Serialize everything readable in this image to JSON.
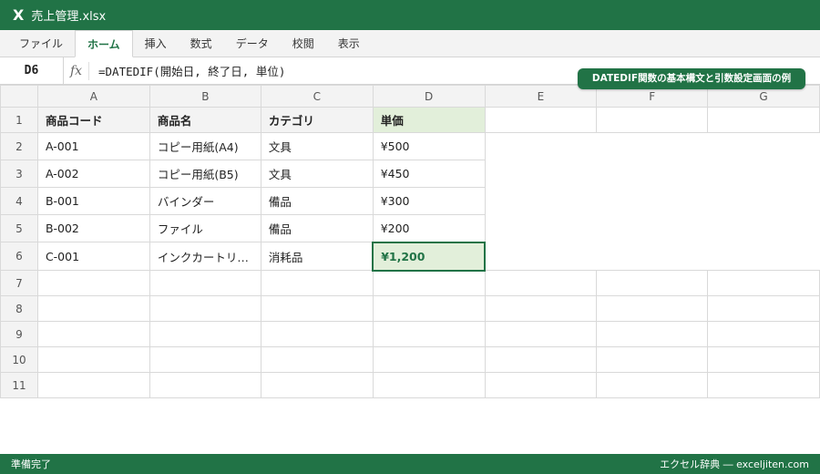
{
  "window": {
    "icon": "excel-x-icon",
    "logo_text": "X",
    "filename": "売上管理.xlsx"
  },
  "ribbon": {
    "tabs": [
      "ファイル",
      "ホーム",
      "挿入",
      "数式",
      "データ",
      "校閲",
      "表示"
    ],
    "active_tab": "ホーム"
  },
  "formula_bar": {
    "cell_ref": "D6",
    "fx_label": "fx",
    "formula": "=DATEDIF(開始日, 終了日, 単位)"
  },
  "callout": "DATEDIF関数の基本構文と引数設定画面の例",
  "sheet": {
    "columns": [
      "A",
      "B",
      "C",
      "D",
      "E",
      "F",
      "G"
    ],
    "row_numbers": [
      "1",
      "2",
      "3",
      "4",
      "5",
      "6",
      "7",
      "8",
      "9",
      "10",
      "11"
    ],
    "headers": [
      "商品コード",
      "商品名",
      "カテゴリ",
      "単価"
    ],
    "rows": [
      [
        "A-001",
        "コピー用紙(A4)",
        "文具",
        "¥500"
      ],
      [
        "A-002",
        "コピー用紙(B5)",
        "文具",
        "¥450"
      ],
      [
        "B-001",
        "バインダー",
        "備品",
        "¥300"
      ],
      [
        "B-002",
        "ファイル",
        "備品",
        "¥200"
      ],
      [
        "C-001",
        "インクカートリ…",
        "消耗品",
        "¥1,200"
      ]
    ],
    "selected_cell": "D6"
  },
  "status_bar": {
    "left": "準備完了",
    "right": "エクセル辞典 ― exceljiten.com"
  },
  "colors": {
    "accent": "#217346",
    "selected_fill": "#e2efda",
    "header_fill": "#f3f3f3"
  }
}
